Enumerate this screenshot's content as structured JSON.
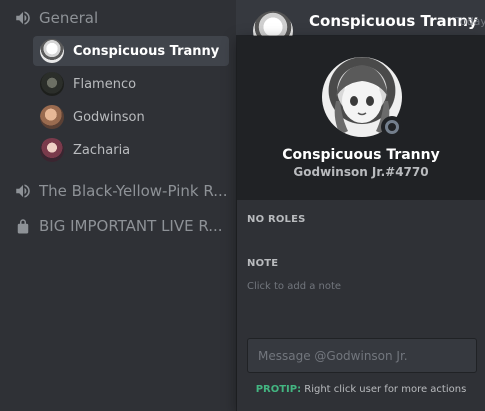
{
  "sidebar": {
    "channels": [
      {
        "label": "General",
        "icon": "speaker-icon"
      },
      {
        "label": "The Black-Yellow-Pink R...",
        "icon": "speaker-icon"
      },
      {
        "label": "BIG IMPORTANT LIVE R...",
        "icon": "lock-icon"
      }
    ],
    "members": [
      {
        "name": "Conspicuous Tranny",
        "selected": true
      },
      {
        "name": "Flamenco"
      },
      {
        "name": "Godwinson"
      },
      {
        "name": "Zacharia"
      }
    ]
  },
  "chat": {
    "header_name": "Conspicuous Tranny",
    "header_timestamp": "Today"
  },
  "popout": {
    "username": "Conspicuous Tranny",
    "tag": "Godwinson Jr.#4770",
    "roles_title": "NO ROLES",
    "note_title": "NOTE",
    "note_placeholder": "Click to add a note",
    "message_placeholder": "Message @Godwinson Jr.",
    "protip_label": "PROTIP:",
    "protip_text": " Right click user for more actions",
    "status": "offline"
  },
  "colors": {
    "background": "#2f3136",
    "popout_header": "#202225",
    "selected_item": "#40444b",
    "protip_green": "#43b581",
    "status_offline": "#747f8d"
  }
}
